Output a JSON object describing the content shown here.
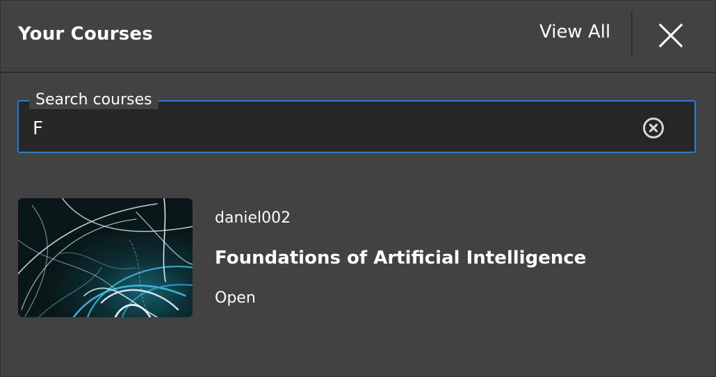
{
  "header": {
    "title": "Your Courses",
    "view_all_label": "View All",
    "close_icon": "close-icon"
  },
  "search": {
    "label": "Search courses",
    "value": "F",
    "clear_icon": "clear-circle-icon"
  },
  "courses": [
    {
      "owner": "daniel002",
      "title": "Foundations of Artificial Intelligence",
      "status": "Open",
      "thumbnail": "light-streaks-image"
    }
  ],
  "colors": {
    "background": "#424242",
    "input_background": "#262626",
    "accent": "#1f7ee6",
    "text": "#ffffff"
  }
}
